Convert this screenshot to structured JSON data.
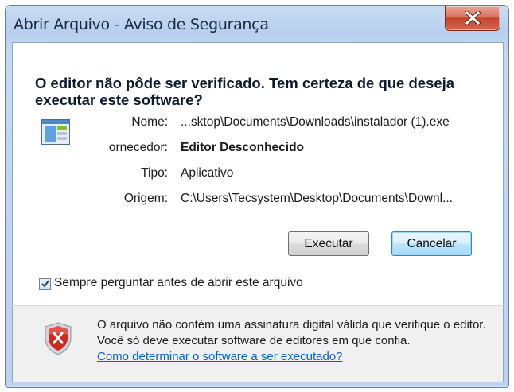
{
  "window": {
    "title": "Abrir Arquivo - Aviso de Segurança",
    "close_icon": "close-x-icon"
  },
  "dialog": {
    "heading": "O editor não pôde ser verificado. Tem certeza de que deseja executar este software?",
    "file_icon": "application-window-icon",
    "fields": [
      {
        "label": "Nome:",
        "value": "...sktop\\Documents\\Downloads\\instalador (1).exe",
        "bold": false
      },
      {
        "label": "ornecedor:",
        "value": "Editor Desconhecido",
        "bold": true
      },
      {
        "label": "Tipo:",
        "value": "Aplicativo",
        "bold": false
      },
      {
        "label": "Origem:",
        "value": "C:\\Users\\Tecsystem\\Desktop\\Documents\\Downl...",
        "bold": false
      }
    ],
    "buttons": {
      "run_label": "Executar",
      "cancel_label": "Cancelar"
    },
    "checkbox": {
      "label": "Sempre perguntar antes de abrir este arquivo",
      "checked": true
    }
  },
  "footer": {
    "icon": "security-shield-error-icon",
    "text": "O arquivo não contém uma assinatura digital válida que verifique o editor. Você só deve executar software de editores em que confia.",
    "link": "Como determinar o software a ser executado?"
  },
  "colors": {
    "titlebar": "#c9dcf3",
    "close_button": "#c4452c",
    "link": "#0a60c9",
    "default_button_border": "#3c7fb1"
  }
}
